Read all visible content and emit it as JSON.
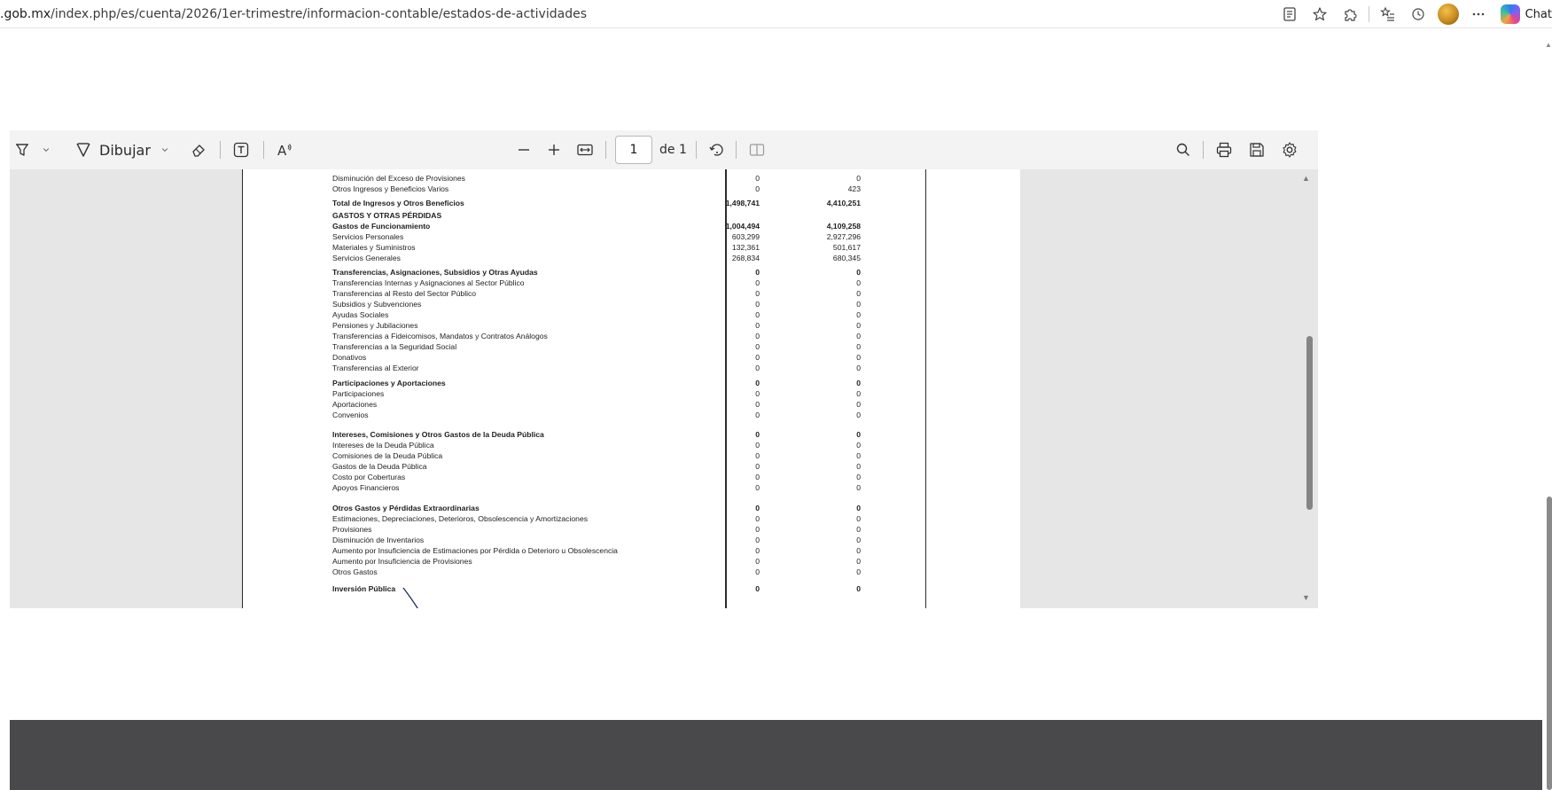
{
  "browser": {
    "url_host": ".gob.mx",
    "url_path": "/index.php/es/cuenta/2026/1er-trimestre/informacion-contable/estados-de-actividades",
    "chat_label": "Chat"
  },
  "pdf_toolbar": {
    "draw_label": "Dibujar",
    "page_current": "1",
    "page_total_label": "de 1"
  },
  "statement": {
    "rows": [
      {
        "label": "Disminución del Exceso de Provisiones",
        "v1": "0",
        "v2": "0",
        "bold": false
      },
      {
        "label": "Otros Ingresos y Beneficios Varios",
        "v1": "0",
        "v2": "423",
        "bold": false
      },
      {
        "label": "Total de Ingresos y Otros Beneficios",
        "v1": "1,498,741",
        "v2": "4,410,251",
        "bold": true
      },
      {
        "label": "GASTOS Y OTRAS PÉRDIDAS",
        "v1": "",
        "v2": "",
        "bold": true
      },
      {
        "label": "Gastos de Funcionamiento",
        "v1": "1,004,494",
        "v2": "4,109,258",
        "bold": true
      },
      {
        "label": "Servicios Personales",
        "v1": "603,299",
        "v2": "2,927,296",
        "bold": false
      },
      {
        "label": "Materiales y Suministros",
        "v1": "132,361",
        "v2": "501,617",
        "bold": false
      },
      {
        "label": "Servicios Generales",
        "v1": "268,834",
        "v2": "680,345",
        "bold": false
      },
      {
        "label": "Transferencias, Asignaciones, Subsidios y Otras Ayudas",
        "v1": "0",
        "v2": "0",
        "bold": true
      },
      {
        "label": "Transferencias Internas y Asignaciones al Sector Público",
        "v1": "0",
        "v2": "0",
        "bold": false
      },
      {
        "label": "Transferencias al Resto del Sector Público",
        "v1": "0",
        "v2": "0",
        "bold": false
      },
      {
        "label": "Subsidios y Subvenciones",
        "v1": "0",
        "v2": "0",
        "bold": false
      },
      {
        "label": "Ayudas Sociales",
        "v1": "0",
        "v2": "0",
        "bold": false
      },
      {
        "label": "Pensiones y Jubilaciones",
        "v1": "0",
        "v2": "0",
        "bold": false
      },
      {
        "label": "Transferencias a Fideicomisos, Mandatos y Contratos Análogos",
        "v1": "0",
        "v2": "0",
        "bold": false
      },
      {
        "label": "Transferencias a la Seguridad Social",
        "v1": "0",
        "v2": "0",
        "bold": false
      },
      {
        "label": "Donativos",
        "v1": "0",
        "v2": "0",
        "bold": false
      },
      {
        "label": "Transferencias al Exterior",
        "v1": "0",
        "v2": "0",
        "bold": false
      },
      {
        "label": "Participaciones y Aportaciones",
        "v1": "0",
        "v2": "0",
        "bold": true
      },
      {
        "label": "Participaciones",
        "v1": "0",
        "v2": "0",
        "bold": false
      },
      {
        "label": "Aportaciones",
        "v1": "0",
        "v2": "0",
        "bold": false
      },
      {
        "label": "Convenios",
        "v1": "0",
        "v2": "0",
        "bold": false
      },
      {
        "label": "Intereses, Comisiones y Otros Gastos de la Deuda Pública",
        "v1": "0",
        "v2": "0",
        "bold": true
      },
      {
        "label": "Intereses de la Deuda Pública",
        "v1": "0",
        "v2": "0",
        "bold": false
      },
      {
        "label": "Comisiones de la Deuda Pública",
        "v1": "0",
        "v2": "0",
        "bold": false
      },
      {
        "label": "Gastos de la Deuda Pública",
        "v1": "0",
        "v2": "0",
        "bold": false
      },
      {
        "label": "Costo por Coberturas",
        "v1": "0",
        "v2": "0",
        "bold": false
      },
      {
        "label": "Apoyos Financieros",
        "v1": "0",
        "v2": "0",
        "bold": false
      },
      {
        "label": "Otros Gastos y Pérdidas Extraordinarias",
        "v1": "0",
        "v2": "0",
        "bold": true
      },
      {
        "label": "Estimaciones, Depreciaciones, Deterioros, Obsolescencia y Amortizaciones",
        "v1": "0",
        "v2": "0",
        "bold": false
      },
      {
        "label": "Provisiones",
        "v1": "0",
        "v2": "0",
        "bold": false
      },
      {
        "label": "Disminución de Inventarios",
        "v1": "0",
        "v2": "0",
        "bold": false
      },
      {
        "label": "Aumento por Insuficiencia de Estimaciones por Pérdida o Deterioro u Obsolescencia",
        "v1": "0",
        "v2": "0",
        "bold": false
      },
      {
        "label": "Aumento por Insuficiencia de Provisiones",
        "v1": "0",
        "v2": "0",
        "bold": false
      },
      {
        "label": "Otros Gastos",
        "v1": "0",
        "v2": "0",
        "bold": false
      },
      {
        "label": "Inversión Pública",
        "v1": "0",
        "v2": "0",
        "bold": true
      }
    ]
  }
}
